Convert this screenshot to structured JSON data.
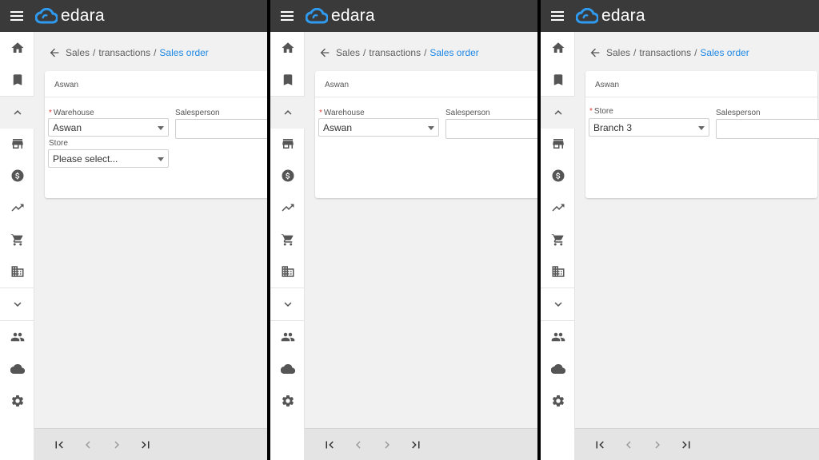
{
  "app": {
    "name": "edara"
  },
  "colors": {
    "topbar": "#3a3a3a",
    "accent": "#1e88e5",
    "required": "#e53935",
    "background": "#f1f1f1"
  },
  "sidebar": {
    "icons": [
      "home-icon",
      "bookmark-icon",
      "chevron-up-icon",
      "store-icon",
      "dollar-icon",
      "trending-up-icon",
      "cart-icon",
      "building-icon",
      "chevron-down-icon",
      "people-icon",
      "cloud-icon",
      "gear-icon"
    ]
  },
  "breadcrumb": {
    "root": "Sales",
    "section": "transactions",
    "current": "Sales order",
    "separator": "/"
  },
  "pager": {
    "buttons": [
      "first-page-icon",
      "previous-page-icon",
      "next-page-icon",
      "last-page-icon"
    ]
  },
  "panels": [
    {
      "card_title": "Aswan",
      "field1": {
        "label": "Warehouse",
        "required": "*",
        "value": "Aswan"
      },
      "salesperson": {
        "label": "Salesperson",
        "value": ""
      },
      "store": {
        "label": "Store",
        "placeholder": "Please select..."
      }
    },
    {
      "card_title": "Aswan",
      "field1": {
        "label": "Warehouse",
        "required": "*",
        "value": "Aswan"
      },
      "salesperson": {
        "label": "Salesperson",
        "value": ""
      }
    },
    {
      "card_title": "Aswan",
      "field1": {
        "label": "Store",
        "required": "*",
        "value": "Branch 3"
      },
      "salesperson": {
        "label": "Salesperson",
        "value": ""
      }
    }
  ]
}
